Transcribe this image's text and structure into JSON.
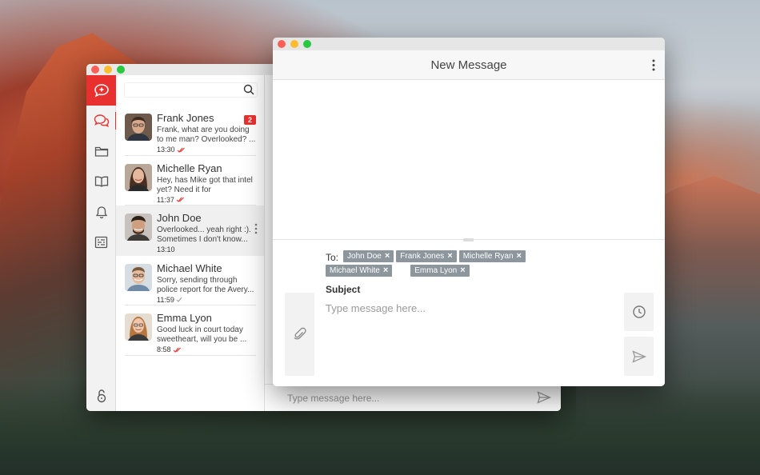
{
  "back_window": {
    "search": {
      "placeholder": ""
    },
    "conversations": [
      {
        "name": "Frank Jones",
        "preview": "Frank, what are you doing to me man? Overlooked? ...",
        "time": "13:30",
        "badge": "2",
        "read": true,
        "selected": false
      },
      {
        "name": "Michelle Ryan",
        "preview": "Hey, has Mike got that intel yet? Need it for tomorrow's...",
        "time": "11:37",
        "badge": "",
        "read": true,
        "selected": false
      },
      {
        "name": "John Doe",
        "preview": "Overlooked... yeah right :). Sometimes I don't know...",
        "time": "13:10",
        "badge": "",
        "read": false,
        "selected": true
      },
      {
        "name": "Michael White",
        "preview": "Sorry, sending through police report for the Avery...",
        "time": "11:59",
        "badge": "",
        "read": false,
        "selected": false
      },
      {
        "name": "Emma Lyon",
        "preview": "Good luck in court today sweetheart, will you be ...",
        "time": "8:58",
        "badge": "",
        "read": true,
        "selected": false
      }
    ],
    "chat_input": {
      "placeholder": "Type message here..."
    }
  },
  "front_window": {
    "title": "New Message",
    "to_label": "To:",
    "recipients": [
      "John Doe",
      "Frank Jones",
      "Michelle Ryan",
      "Michael White",
      "Emma Lyon"
    ],
    "chip_remove_glyph": "×",
    "subject_label": "Subject",
    "message_placeholder": "Type message here..."
  },
  "colors": {
    "accent": "#e8312f",
    "chip": "#8c969c",
    "read_check": "#e8312f",
    "unread_check": "#9aa0a6"
  },
  "icons": {
    "sidebar": [
      "compose-chat-icon",
      "chats-icon",
      "folder-icon",
      "book-icon",
      "bell-icon",
      "settings-list-icon",
      "lock-icon"
    ]
  }
}
